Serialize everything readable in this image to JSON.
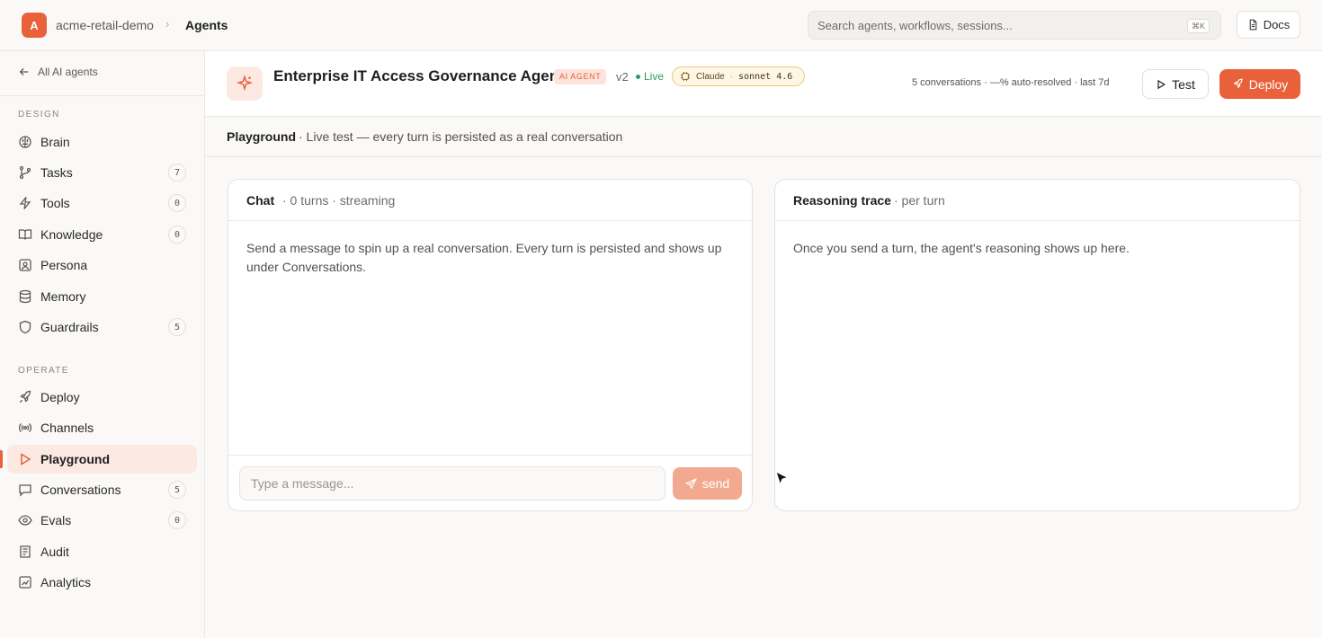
{
  "topbar": {
    "workspace_initial": "A",
    "workspace_name": "acme-retail-demo",
    "breadcrumb_separator": "›",
    "breadcrumb_current": "Agents",
    "search_placeholder": "Search agents, workflows, sessions...",
    "search_shortcut": "⌘K",
    "docs_label": "Docs"
  },
  "sidebar": {
    "back_label": "All AI agents",
    "design_label": "DESIGN",
    "operate_label": "OPERATE",
    "design_items": [
      {
        "label": "Brain",
        "icon": "brain-icon",
        "count": ""
      },
      {
        "label": "Tasks",
        "icon": "branch-icon",
        "count": "7"
      },
      {
        "label": "Tools",
        "icon": "bolt-icon",
        "count": "0"
      },
      {
        "label": "Knowledge",
        "icon": "book-icon",
        "count": "0"
      },
      {
        "label": "Persona",
        "icon": "persona-icon",
        "count": ""
      },
      {
        "label": "Memory",
        "icon": "database-icon",
        "count": ""
      },
      {
        "label": "Guardrails",
        "icon": "shield-icon",
        "count": "5"
      }
    ],
    "operate_items": [
      {
        "label": "Deploy",
        "icon": "rocket-icon",
        "count": ""
      },
      {
        "label": "Channels",
        "icon": "broadcast-icon",
        "count": ""
      },
      {
        "label": "Playground",
        "icon": "play-icon",
        "count": "",
        "active": true
      },
      {
        "label": "Conversations",
        "icon": "chat-icon",
        "count": "5"
      },
      {
        "label": "Evals",
        "icon": "eye-icon",
        "count": "0"
      },
      {
        "label": "Audit",
        "icon": "audit-icon",
        "count": ""
      },
      {
        "label": "Analytics",
        "icon": "analytics-icon",
        "count": ""
      }
    ]
  },
  "agent": {
    "name": "Enterprise IT Access Governance Agent",
    "tag": "AI AGENT",
    "version": "v2",
    "status": "Live",
    "model_vendor": "Claude",
    "model_sep": "·",
    "model_version": "sonnet 4.6",
    "stats": "5 conversations · —% auto-resolved · last 7d",
    "test_label": "Test",
    "deploy_label": "Deploy"
  },
  "playground": {
    "title": "Playground",
    "description": "· Live test — every turn is persisted as a real conversation"
  },
  "chat": {
    "title": "Chat",
    "meta": "· 0 turns · streaming",
    "empty_text": "Send a message to spin up a real conversation. Every turn is persisted and shows up under Conversations.",
    "input_placeholder": "Type a message...",
    "send_label": "send"
  },
  "trace": {
    "title": "Reasoning trace",
    "meta": "· per turn",
    "empty_text": "Once you send a turn, the agent's reasoning shows up here."
  },
  "colors": {
    "accent": "#e8613a",
    "accent_soft": "#fbe9e2",
    "live": "#2e9b5f"
  }
}
